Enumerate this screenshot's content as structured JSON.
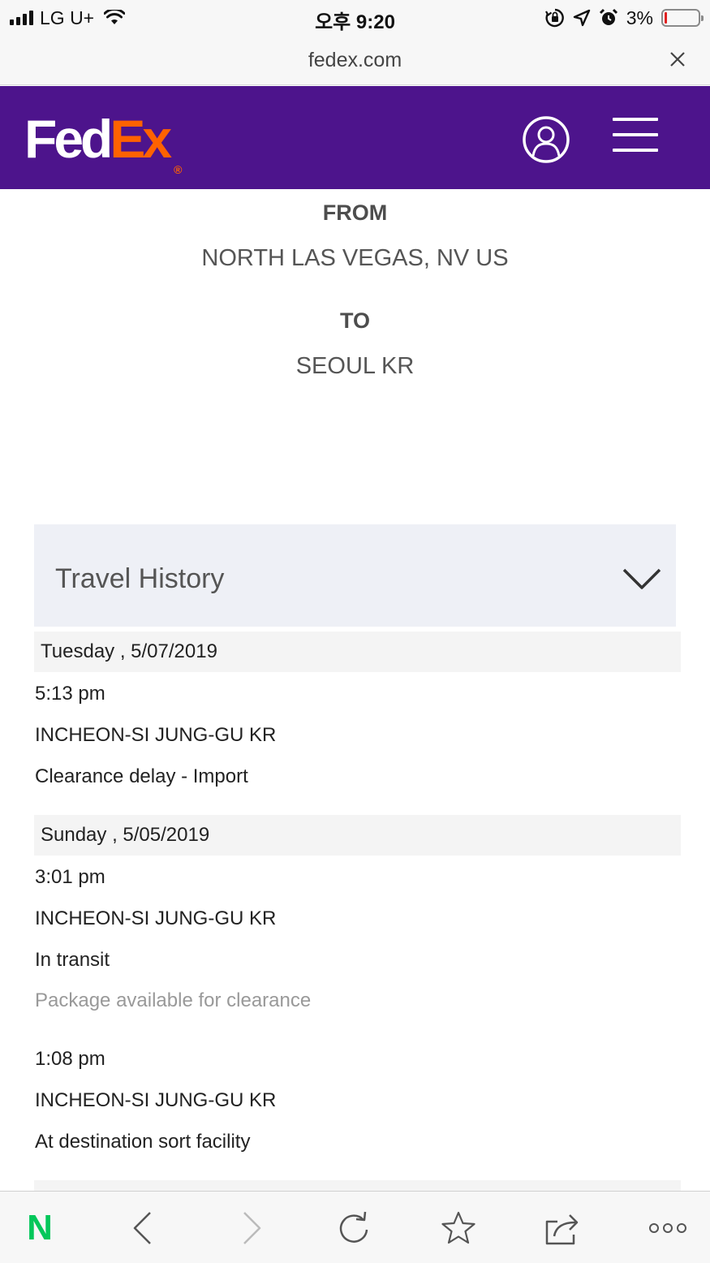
{
  "status_bar": {
    "carrier": "LG U+",
    "time": "오후 9:20",
    "battery_percent": "3%",
    "battery_level": 0.03,
    "battery_low_color": "#e02020"
  },
  "browser": {
    "url": "fedex.com",
    "close_icon": "close-icon"
  },
  "header": {
    "logo_fed": "Fed",
    "logo_ex": "Ex",
    "logo_reg": "®",
    "brand_purple": "#4d148c",
    "brand_orange": "#ff6200",
    "profile_icon": "user-circle-icon",
    "menu_icon": "hamburger-menu-icon"
  },
  "shipment": {
    "from_label": "FROM",
    "from_value": "NORTH LAS VEGAS, NV US",
    "to_label": "TO",
    "to_value": "SEOUL KR"
  },
  "travel_history": {
    "title": "Travel History",
    "toggle_icon": "chevron-down-icon",
    "days": [
      {
        "date": "Tuesday , 5/07/2019",
        "events": [
          {
            "time": "5:13 pm",
            "location": "INCHEON-SI JUNG-GU KR",
            "status": "Clearance delay - Import"
          }
        ]
      },
      {
        "date": "Sunday , 5/05/2019",
        "events": [
          {
            "time": "3:01 pm",
            "location": "INCHEON-SI JUNG-GU KR",
            "status": "In transit",
            "detail": "Package available for clearance"
          },
          {
            "time": "1:08 pm",
            "location": "INCHEON-SI JUNG-GU KR",
            "status": "At destination sort facility"
          }
        ]
      }
    ]
  },
  "toolbar": {
    "home_label": "N",
    "home_color": "#03c75a",
    "icons": [
      "back-icon",
      "forward-icon",
      "refresh-icon",
      "bookmark-star-icon",
      "share-icon",
      "more-icon"
    ]
  }
}
